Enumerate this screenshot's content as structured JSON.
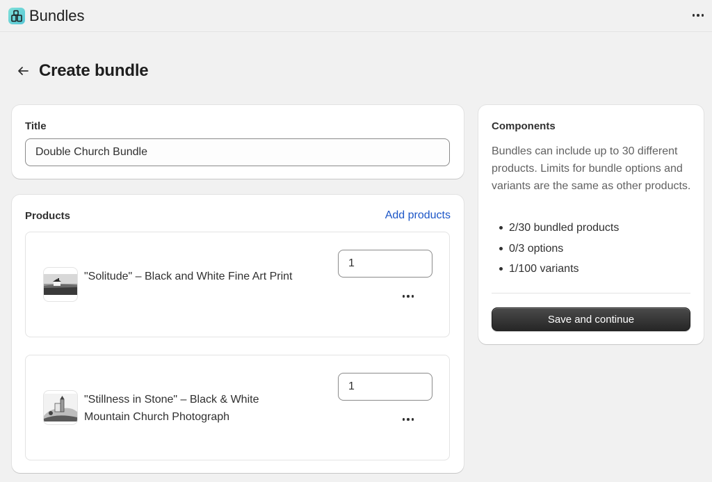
{
  "app": {
    "title": "Bundles",
    "icon": "bundles-app-icon"
  },
  "page": {
    "title": "Create bundle"
  },
  "title_card": {
    "label": "Title",
    "value": "Double Church Bundle"
  },
  "products": {
    "label": "Products",
    "add_label": "Add products",
    "items": [
      {
        "name": "\"Solitude\" – Black and White Fine Art Print",
        "quantity": "1",
        "thumb": "church-photo-thumbnail"
      },
      {
        "name": "\"Stillness in Stone\" – Black & White Mountain Church Photograph",
        "quantity": "1",
        "thumb": "church-photo-thumbnail"
      }
    ]
  },
  "components": {
    "label": "Components",
    "description": "Bundles can include up to 30 different products. Limits for bundle options and variants are the same as other products.",
    "limits": [
      "2/30 bundled products",
      "0/3 options",
      "1/100 variants"
    ],
    "save_label": "Save and continue"
  },
  "colors": {
    "link": "#1c56c7",
    "primary_button": "#303030",
    "background": "#f1f1f1"
  }
}
